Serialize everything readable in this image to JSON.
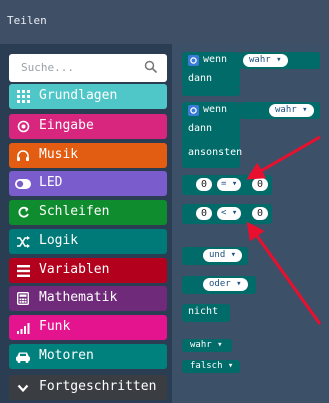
{
  "header": {
    "title": "Teilen"
  },
  "search": {
    "placeholder": "Suche..."
  },
  "categories": [
    {
      "label": "Grundlagen",
      "icon": "grid-icon",
      "color": "#4fc7c9"
    },
    {
      "label": "Eingabe",
      "icon": "target-icon",
      "color": "#d8267e"
    },
    {
      "label": "Musik",
      "icon": "headphones-icon",
      "color": "#e25c12"
    },
    {
      "label": "LED",
      "icon": "toggle-icon",
      "color": "#7b5ccd"
    },
    {
      "label": "Schleifen",
      "icon": "loop-icon",
      "color": "#0f8c2e"
    },
    {
      "label": "Logik",
      "icon": "shuffle-icon",
      "color": "#007a78"
    },
    {
      "label": "Variablen",
      "icon": "list-icon",
      "color": "#b3001d"
    },
    {
      "label": "Mathematik",
      "icon": "calculator-icon",
      "color": "#6f2a7a"
    },
    {
      "label": "Funk",
      "icon": "signal-icon",
      "color": "#e4148e"
    },
    {
      "label": "Motoren",
      "icon": "car-icon",
      "color": "#00817e"
    },
    {
      "label": "Fortgeschritten",
      "icon": "chevron-down-icon",
      "color": "#3a3d42"
    }
  ],
  "blocks": {
    "if_then": {
      "wenn": "wenn",
      "value": "wahr",
      "dann": "dann"
    },
    "if_then_else": {
      "wenn": "wenn",
      "value": "wahr",
      "dann": "dann",
      "ansonsten": "ansonsten"
    },
    "compare_eq": {
      "left": "0",
      "op": "=",
      "right": "0"
    },
    "compare_lt": {
      "left": "0",
      "op": "<",
      "right": "0"
    },
    "and": {
      "op": "und"
    },
    "or": {
      "op": "oder"
    },
    "not": {
      "label": "nicht"
    },
    "true": {
      "label": "wahr"
    },
    "false": {
      "label": "falsch"
    }
  },
  "colors": {
    "logic_block": "#006b69",
    "annotation_arrow": "#e8102e",
    "workspace": "#3c5068",
    "toolbox": "#2b3d53"
  }
}
